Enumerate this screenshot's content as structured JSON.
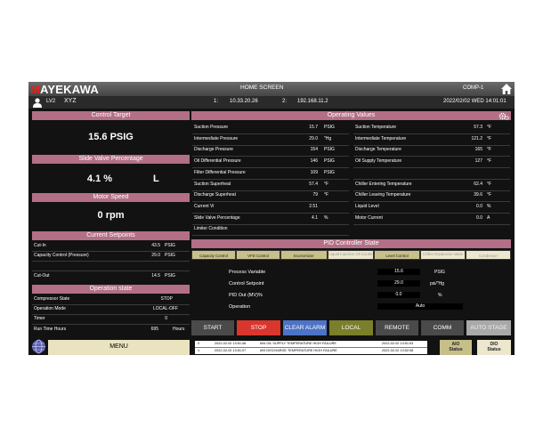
{
  "header": {
    "logo_text": "MAYEKAWA",
    "title": "HOME SCREEN",
    "compressor": "COMP-1",
    "user_level": "LV2",
    "user_name": "XYZ",
    "ip1_label": "1:",
    "ip1": "10.33.20.26",
    "ip2_label": "2:",
    "ip2": "192.168.11.2",
    "datetime": "2022/02/02 WED 14:01:01"
  },
  "control_target": {
    "title": "Control Target",
    "value": "15.6 PSIG"
  },
  "slide_valve": {
    "title": "Slide Valve Percentage",
    "value": "4.1 %",
    "mode": "L"
  },
  "motor_speed": {
    "title": "Motor Speed",
    "value": "0 rpm"
  },
  "current_setpoints": {
    "title": "Current Setpoints",
    "rows": [
      {
        "label": "Cut-In",
        "value": "43.5",
        "unit": "PSIG"
      },
      {
        "label": "Capacity Control (Pressure)",
        "value": "29.0",
        "unit": "PSIG"
      },
      {
        "label": "Cut-Out",
        "value": "14.5",
        "unit": "PSIG"
      }
    ]
  },
  "operation_state": {
    "title": "Operation state",
    "rows": [
      {
        "label": "Compressor State",
        "value": "STOP",
        "unit": ""
      },
      {
        "label": "Operation Mode",
        "value": "LOCAL-OFF",
        "unit": ""
      },
      {
        "label": "Timer",
        "value": "0",
        "unit": ""
      },
      {
        "label": "Run Time Hours",
        "value": "695",
        "unit": "Hours"
      }
    ]
  },
  "menu_label": "MENU",
  "operating_values": {
    "title": "Operating Values",
    "left": [
      {
        "label": "Suction Pressure",
        "value": "15.7",
        "unit": "PSIG"
      },
      {
        "label": "Intermediate Pressure",
        "value": "29.0",
        "unit": "\"Hg"
      },
      {
        "label": "Discharge Pressure",
        "value": "154",
        "unit": "PSIG"
      },
      {
        "label": "Oil Differential Pressure",
        "value": "146",
        "unit": "PSIG"
      },
      {
        "label": "Filter Differential Pressure",
        "value": "109",
        "unit": "PSIG"
      },
      {
        "label": "Suction Superheat",
        "value": "57.4",
        "unit": "°F"
      },
      {
        "label": "Discharge Superheat",
        "value": "79",
        "unit": "°F"
      },
      {
        "label": "Current Vi",
        "value": "2.51",
        "unit": ""
      },
      {
        "label": "Slide Valve Percentage",
        "value": "4.1",
        "unit": "%"
      },
      {
        "label": "Limiter Condition",
        "value": "",
        "unit": ""
      }
    ],
    "right": [
      {
        "label": "Suction Temperature",
        "value": "57.3",
        "unit": "°F"
      },
      {
        "label": "Intermediate Temperature",
        "value": "121.2",
        "unit": "°F"
      },
      {
        "label": "Discharge Temperature",
        "value": "165",
        "unit": "°F"
      },
      {
        "label": "Oil Supply Temperature",
        "value": "127",
        "unit": "°F"
      },
      {
        "label": "",
        "value": "",
        "unit": ""
      },
      {
        "label": "Chiller Entering Temperature",
        "value": "62.4",
        "unit": "°F"
      },
      {
        "label": "Chiller Leaving Temperature",
        "value": "39.6",
        "unit": "°F"
      },
      {
        "label": "Liquid Level",
        "value": "0.0",
        "unit": "%"
      },
      {
        "label": "Motor Current",
        "value": "0.0",
        "unit": "A"
      }
    ]
  },
  "pid": {
    "title": "PID Controller State",
    "tabs": [
      {
        "label": "Capacity Control"
      },
      {
        "label": "VFD Control"
      },
      {
        "label": "Economizer"
      },
      {
        "label": "Liquid Injection Oil Cooler"
      },
      {
        "label": "Level Control"
      },
      {
        "label": "Chiller Expansion Valve"
      },
      {
        "label": "Condenser"
      }
    ],
    "rows": [
      {
        "label": "Process Variable",
        "value": "15.6",
        "unit": "PSIG"
      },
      {
        "label": "Control Setpoint",
        "value": "29.0",
        "unit": "psi/\"Hg"
      },
      {
        "label": "PID Out (MV)%",
        "value": "0.0",
        "unit": "%"
      },
      {
        "label": "Operation",
        "value": "Auto",
        "unit": ""
      }
    ]
  },
  "buttons": {
    "start": "START",
    "stop": "STOP",
    "clear_alarm": "CLEAR ALARM",
    "local": "LOCAL",
    "remote": "REMOTE",
    "comm": "COMM",
    "auto_stage": "AUTO STAGE"
  },
  "alarms": [
    {
      "index": "0",
      "time1": "2022-02-02 13:51:46",
      "message": "#94 OIL SUPPLY TEMPERATURE HIGH FAILURE",
      "time2": "2022-02-02 13:51:53"
    },
    {
      "index": "1",
      "time1": "2022-02-02 13:51:07",
      "message": "#93 DISCHARGE TEMPERATURE HIGH FAILURE",
      "time2": "2022-02-02 13:52:08"
    }
  ],
  "status": {
    "aio_line1": "AIO",
    "aio_line2": "Status",
    "dio_line1": "DIO",
    "dio_line2": "Status"
  },
  "colors": {
    "panel_header": "#b26f86",
    "background": "#121212",
    "stop_button": "#d9362e",
    "clear_alarm_button": "#4d73c6",
    "local_button": "#7a7f2b",
    "status_indicator": "#c7bf8a"
  }
}
